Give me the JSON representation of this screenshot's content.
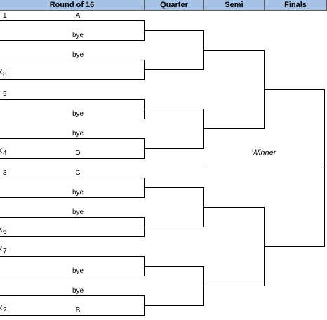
{
  "header": {
    "round16": "Round of 16",
    "quarter": "Quarter",
    "semi": "Semi",
    "finals": "Finals"
  },
  "seeds": [
    "1",
    "8",
    "5",
    "4",
    "3",
    "6",
    "7",
    "2"
  ],
  "entries": [
    "A",
    "bye",
    "bye",
    "bye",
    "bye",
    "D",
    "C",
    "bye",
    "bye",
    "bye",
    "bye",
    "B"
  ],
  "winner_label": "Winner"
}
